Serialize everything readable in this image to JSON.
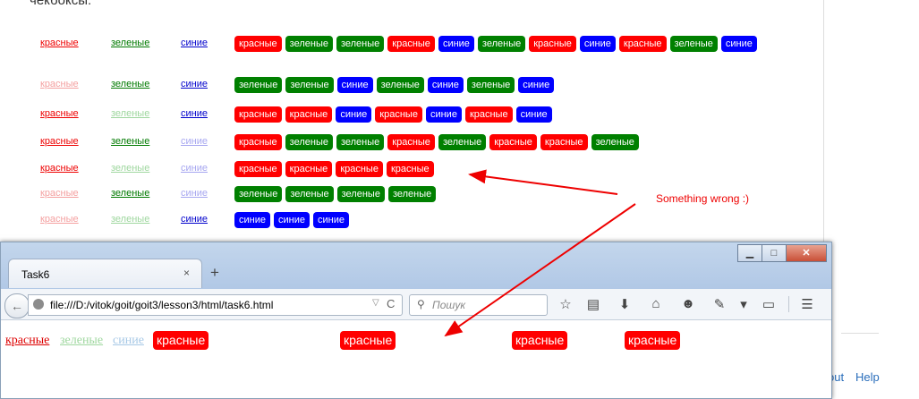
{
  "page": {
    "heading_fragment": "чекбоксы:",
    "rows": [
      {
        "filters": [
          {
            "label": "красные",
            "color": "red",
            "active": true
          },
          {
            "label": "зеленые",
            "color": "green",
            "active": true
          },
          {
            "label": "синие",
            "color": "blue",
            "active": true
          }
        ],
        "tags": [
          {
            "label": "красные",
            "color": "red"
          },
          {
            "label": "зеленые",
            "color": "green"
          },
          {
            "label": "зеленые",
            "color": "green"
          },
          {
            "label": "красные",
            "color": "red"
          },
          {
            "label": "синие",
            "color": "blue"
          },
          {
            "label": "зеленые",
            "color": "green"
          },
          {
            "label": "красные",
            "color": "red"
          },
          {
            "label": "синие",
            "color": "blue"
          },
          {
            "label": "красные",
            "color": "red"
          },
          {
            "label": "зеленые",
            "color": "green"
          },
          {
            "label": "синие",
            "color": "blue"
          }
        ]
      },
      {
        "filters": [
          {
            "label": "красные",
            "color": "red",
            "active": false
          },
          {
            "label": "зеленые",
            "color": "green",
            "active": true
          },
          {
            "label": "синие",
            "color": "blue",
            "active": true
          }
        ],
        "tags": [
          {
            "label": "зеленые",
            "color": "green"
          },
          {
            "label": "зеленые",
            "color": "green"
          },
          {
            "label": "синие",
            "color": "blue"
          },
          {
            "label": "зеленые",
            "color": "green"
          },
          {
            "label": "синие",
            "color": "blue"
          },
          {
            "label": "зеленые",
            "color": "green"
          },
          {
            "label": "синие",
            "color": "blue"
          }
        ]
      },
      {
        "filters": [
          {
            "label": "красные",
            "color": "red",
            "active": true
          },
          {
            "label": "зеленые",
            "color": "green",
            "active": false
          },
          {
            "label": "синие",
            "color": "blue",
            "active": true
          }
        ],
        "tags": [
          {
            "label": "красные",
            "color": "red"
          },
          {
            "label": "красные",
            "color": "red"
          },
          {
            "label": "синие",
            "color": "blue"
          },
          {
            "label": "красные",
            "color": "red"
          },
          {
            "label": "синие",
            "color": "blue"
          },
          {
            "label": "красные",
            "color": "red"
          },
          {
            "label": "синие",
            "color": "blue"
          }
        ]
      },
      {
        "filters": [
          {
            "label": "красные",
            "color": "red",
            "active": true
          },
          {
            "label": "зеленые",
            "color": "green",
            "active": true
          },
          {
            "label": "синие",
            "color": "blue",
            "active": false
          }
        ],
        "tags": [
          {
            "label": "красные",
            "color": "red"
          },
          {
            "label": "зеленые",
            "color": "green"
          },
          {
            "label": "зеленые",
            "color": "green"
          },
          {
            "label": "красные",
            "color": "red"
          },
          {
            "label": "зеленые",
            "color": "green"
          },
          {
            "label": "красные",
            "color": "red"
          },
          {
            "label": "красные",
            "color": "red"
          },
          {
            "label": "зеленые",
            "color": "green"
          }
        ]
      },
      {
        "filters": [
          {
            "label": "красные",
            "color": "red",
            "active": true
          },
          {
            "label": "зеленые",
            "color": "green",
            "active": false
          },
          {
            "label": "синие",
            "color": "blue",
            "active": false
          }
        ],
        "tags": [
          {
            "label": "красные",
            "color": "red"
          },
          {
            "label": "красные",
            "color": "red"
          },
          {
            "label": "красные",
            "color": "red"
          },
          {
            "label": "красные",
            "color": "red"
          }
        ]
      },
      {
        "filters": [
          {
            "label": "красные",
            "color": "red",
            "active": false
          },
          {
            "label": "зеленые",
            "color": "green",
            "active": true
          },
          {
            "label": "синие",
            "color": "blue",
            "active": false
          }
        ],
        "tags": [
          {
            "label": "зеленые",
            "color": "green"
          },
          {
            "label": "зеленые",
            "color": "green"
          },
          {
            "label": "зеленые",
            "color": "green"
          },
          {
            "label": "зеленые",
            "color": "green"
          }
        ]
      },
      {
        "filters": [
          {
            "label": "красные",
            "color": "red",
            "active": false
          },
          {
            "label": "зеленые",
            "color": "green",
            "active": false
          },
          {
            "label": "синие",
            "color": "blue",
            "active": true
          }
        ],
        "tags": [
          {
            "label": "синие",
            "color": "blue"
          },
          {
            "label": "синие",
            "color": "blue"
          },
          {
            "label": "синие",
            "color": "blue"
          }
        ]
      }
    ],
    "annotation": "Something wrong :)",
    "footer_link_1": "out",
    "footer_link_2": "Help"
  },
  "browser": {
    "tab_title": "Task6",
    "tab_close": "×",
    "new_tab": "+",
    "win_min": "▁",
    "win_max": "□",
    "win_close": "✕",
    "back": "←",
    "url": "file:///D:/vitok/goit/goit3/lesson3/html/task6.html",
    "url_dropdown": "▽",
    "reload": "C",
    "search_placeholder": "Пошук",
    "toolbar_icons": [
      "☆",
      "▤",
      "⬇",
      "⌂",
      "☻",
      "✎",
      "▾",
      "▭",
      "☰"
    ],
    "viewport": {
      "filters": [
        {
          "label": "красные"
        },
        {
          "label": "зеленые"
        },
        {
          "label": "синие"
        }
      ],
      "tags": [
        {
          "label": "красные"
        },
        {
          "label": "красные"
        },
        {
          "label": "красные"
        },
        {
          "label": "красные"
        }
      ]
    }
  },
  "colors": {
    "red": "#ff0000",
    "green": "#008000",
    "blue": "#0000ff",
    "annotation": "#e00000"
  }
}
